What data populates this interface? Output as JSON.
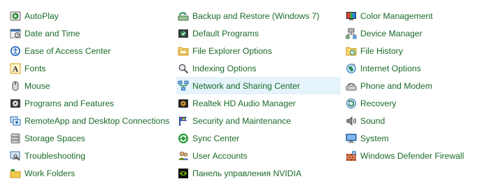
{
  "columns": [
    {
      "items": [
        {
          "label": "AutoPlay",
          "icon": "autoplay-icon",
          "color": "#3a8f3a"
        },
        {
          "label": "Date and Time",
          "icon": "date-time-icon",
          "color": "#3a6ea5"
        },
        {
          "label": "Ease of Access Center",
          "icon": "ease-of-access-icon",
          "color": "#2d6fc0"
        },
        {
          "label": "Fonts",
          "icon": "fonts-icon",
          "color": "#d4a017"
        },
        {
          "label": "Mouse",
          "icon": "mouse-icon",
          "color": "#555555"
        },
        {
          "label": "Programs and Features",
          "icon": "programs-features-icon",
          "color": "#444444"
        },
        {
          "label": "RemoteApp and Desktop Connections",
          "icon": "remoteapp-icon",
          "color": "#2b6cb0"
        },
        {
          "label": "Storage Spaces",
          "icon": "storage-spaces-icon",
          "color": "#777777"
        },
        {
          "label": "Troubleshooting",
          "icon": "troubleshooting-icon",
          "color": "#3a6ea5"
        },
        {
          "label": "Work Folders",
          "icon": "work-folders-icon",
          "color": "#d4a017"
        }
      ]
    },
    {
      "items": [
        {
          "label": "Backup and Restore (Windows 7)",
          "icon": "backup-restore-icon",
          "color": "#2e8b57"
        },
        {
          "label": "Default Programs",
          "icon": "default-programs-icon",
          "color": "#2e8b57"
        },
        {
          "label": "File Explorer Options",
          "icon": "file-explorer-options-icon",
          "color": "#e0b23c"
        },
        {
          "label": "Indexing Options",
          "icon": "indexing-options-icon",
          "color": "#777777"
        },
        {
          "label": "Network and Sharing Center",
          "icon": "network-sharing-icon",
          "color": "#2b6cb0",
          "hovered": true
        },
        {
          "label": "Realtek HD Audio Manager",
          "icon": "realtek-audio-icon",
          "color": "#333333"
        },
        {
          "label": "Security and Maintenance",
          "icon": "security-maintenance-icon",
          "color": "#2b4ea0"
        },
        {
          "label": "Sync Center",
          "icon": "sync-center-icon",
          "color": "#2e9d3e"
        },
        {
          "label": "User Accounts",
          "icon": "user-accounts-icon",
          "color": "#6b8e23"
        },
        {
          "label": "Панель управления NVIDIA",
          "icon": "nvidia-icon",
          "color": "#76b900"
        }
      ]
    },
    {
      "items": [
        {
          "label": "Color Management",
          "icon": "color-management-icon",
          "color": "#2b6cb0"
        },
        {
          "label": "Device Manager",
          "icon": "device-manager-icon",
          "color": "#555555"
        },
        {
          "label": "File History",
          "icon": "file-history-icon",
          "color": "#e0b23c"
        },
        {
          "label": "Internet Options",
          "icon": "internet-options-icon",
          "color": "#2e8b57"
        },
        {
          "label": "Phone and Modem",
          "icon": "phone-modem-icon",
          "color": "#666666"
        },
        {
          "label": "Recovery",
          "icon": "recovery-icon",
          "color": "#2b6cb0"
        },
        {
          "label": "Sound",
          "icon": "sound-icon",
          "color": "#777777"
        },
        {
          "label": "System",
          "icon": "system-icon",
          "color": "#2b6cb0"
        },
        {
          "label": "Windows Defender Firewall",
          "icon": "firewall-icon",
          "color": "#b5451b"
        }
      ]
    }
  ]
}
